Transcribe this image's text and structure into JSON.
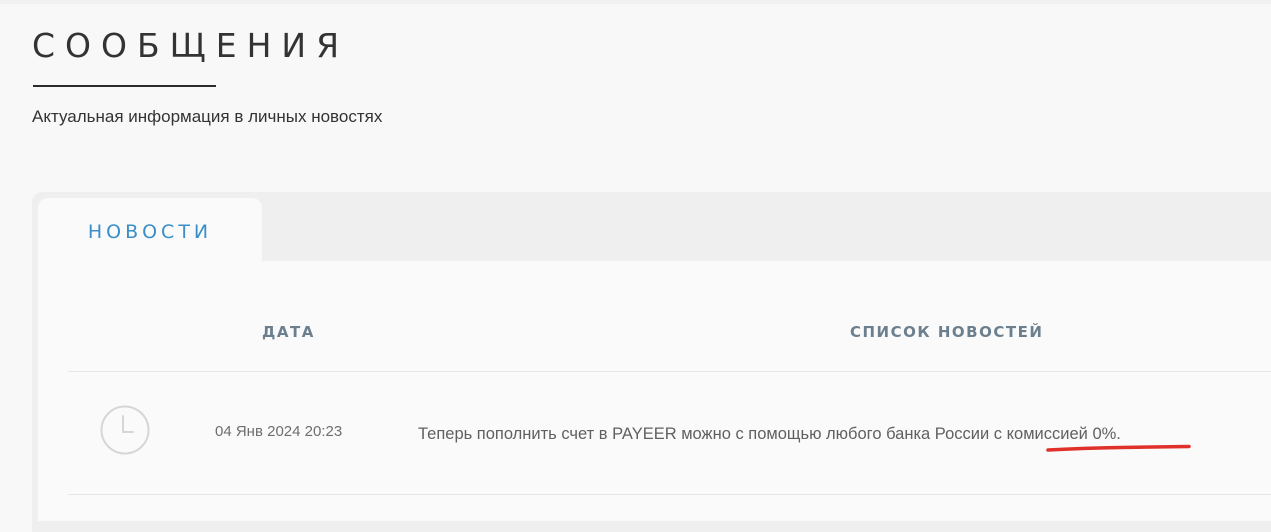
{
  "page": {
    "title": "СООБЩЕНИЯ",
    "subtitle": "Актуальная информация в личных новостях"
  },
  "tabs": [
    {
      "label": "НОВОСТИ",
      "active": true
    }
  ],
  "table": {
    "headers": {
      "date": "ДАТА",
      "list": "СПИСОК НОВОСТЕЙ"
    },
    "rows": [
      {
        "icon": "clock-icon",
        "date": "04 Янв 2024 20:23",
        "text": "Теперь пополнить счет в PAYEER можно с помощью любого банка России с комиссией 0%."
      }
    ]
  },
  "annotation": {
    "highlighted_phrase": "с комиссией 0%.",
    "color": "#e0302a"
  },
  "colors": {
    "background": "#f8f8f8",
    "panel": "#efefef",
    "content": "#fafafa",
    "tab_accent": "#3a8fc9",
    "header_text": "#6b7f8e"
  }
}
